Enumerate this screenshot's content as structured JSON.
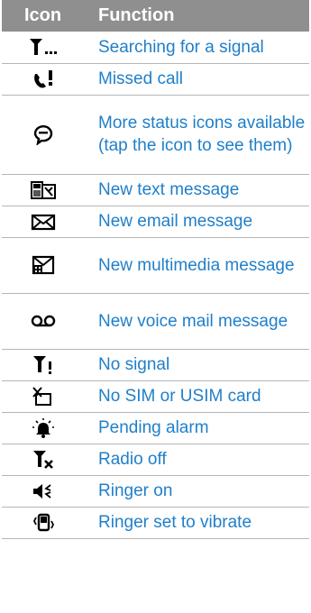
{
  "header": {
    "icon_label": "Icon",
    "function_label": "Function"
  },
  "rows": [
    {
      "icon": "signal-searching-icon",
      "function": "Searching for a signal"
    },
    {
      "icon": "missed-call-icon",
      "function": "Missed call"
    },
    {
      "icon": "more-status-icon",
      "function": "More status icons available (tap the icon to see them)"
    },
    {
      "icon": "text-message-icon",
      "function": "New text message"
    },
    {
      "icon": "email-message-icon",
      "function": "New email message"
    },
    {
      "icon": "multimedia-message-icon",
      "function": "New multimedia message"
    },
    {
      "icon": "voicemail-icon",
      "function": "New voice mail message"
    },
    {
      "icon": "no-signal-icon",
      "function": "No signal"
    },
    {
      "icon": "no-sim-icon",
      "function": "No SIM or USIM card"
    },
    {
      "icon": "alarm-icon",
      "function": "Pending alarm"
    },
    {
      "icon": "radio-off-icon",
      "function": "Radio off"
    },
    {
      "icon": "ringer-on-icon",
      "function": "Ringer on"
    },
    {
      "icon": "vibrate-icon",
      "function": "Ringer set to vibrate"
    }
  ],
  "colors": {
    "header_bg": "#8f8f8f",
    "header_text": "#ffffff",
    "function_text": "#1f7fc9",
    "divider": "#b5b5b5"
  }
}
